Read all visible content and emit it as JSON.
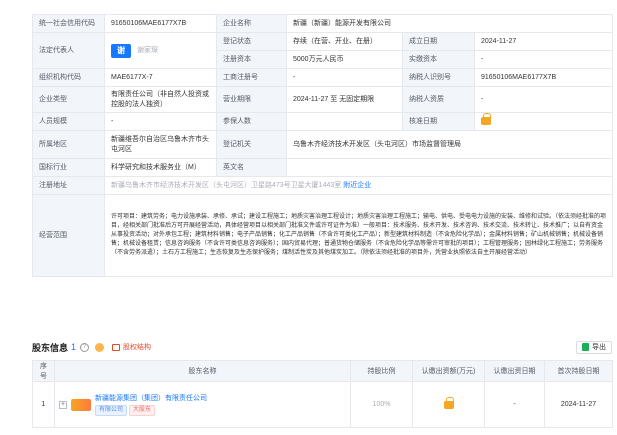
{
  "company": {
    "credit_code_label": "统一社会信用代码",
    "credit_code": "91650106MAE6177X7B",
    "name_label": "企业名称",
    "name": "新疆（新疆）能源开发有限公司",
    "legal_rep_label": "法定代表人",
    "legal_rep_logo": "谢",
    "legal_rep": "谢家琛",
    "status_label": "登记状态",
    "status": "存续（在营、开业、在册）",
    "est_date_label": "成立日期",
    "est_date": "2024-11-27",
    "reg_capital_label": "注册资本",
    "reg_capital": "5000万元人民币",
    "paid_capital_label": "实缴资本",
    "paid_capital": "-",
    "org_code_label": "组织机构代码",
    "org_code": "MAE6177X-7",
    "biz_reg_label": "工商注册号",
    "biz_reg": "-",
    "taxpayer_id_label": "纳税人识别号",
    "taxpayer_id": "91650106MAE6177X7B",
    "company_type_label": "企业类型",
    "company_type": "有限责任公司（非自然人投资或控股的法人独资）",
    "term_label": "营业期限",
    "term": "2024-11-27 至 无固定期限",
    "taxpayer_qual_label": "纳税人资质",
    "taxpayer_qual": "-",
    "staff_label": "人员规模",
    "staff": "-",
    "insured_label": "参保人数",
    "insured": "",
    "approval_date_label": "核准日期",
    "region_label": "所属地区",
    "region": "新疆维吾尔自治区乌鲁木齐市头屯河区",
    "authority_label": "登记机关",
    "authority": "乌鲁木齐经济技术开发区（头屯河区）市场监督管理局",
    "industry_label": "国标行业",
    "industry": "科学研究和技术服务业（M）",
    "english_label": "英文名",
    "english": "",
    "address_label": "注册地址",
    "address": "新疆乌鲁木齐市经济技术开发区（头屯河区）卫星路473号卫星大厦1443室",
    "nearby": "附近企业",
    "scope_label": "经营范围",
    "scope": "许可项目：建筑劳务；电力设施承装、承修、承试；建设工程施工；地质灾害治理工程设计；地质灾害治理工程施工；输电、供电、受电电力设施的安装、维修和试验。（依法须经批准的项目，经相关部门批准后方可开展经营活动，具体经营项目以相关部门批准文件或许可证件为准）一般项目：技术服务、技术开发、技术咨询、技术交流、技术转让、技术推广；以自有资金从事投资活动；对外承包工程；建筑材料销售；电子产品销售；化工产品销售（不含许可类化工产品）；新型建筑材料制造（不含危险化学品）；金属材料销售；矿山机械销售；机械设备销售；机械设备租赁；信息咨询服务（不含许可类信息咨询服务）；国内贸易代理；普通货物仓储服务（不含危险化学品等需许可审批的项目）；工程管理服务；园林绿化工程施工；劳务服务（不含劳务派遣）；土石方工程施工；生态恢复及生态保护服务；煤制活性炭及其他煤炭加工。（除依法须经批准的项目外，凭营业执照依法自主开展经营活动）"
  },
  "shareholders": {
    "title": "股东信息",
    "count": "1",
    "structure_link": "股权结构",
    "export": "导出",
    "columns": [
      "序号",
      "股东名称",
      "持股比例",
      "认缴出资额(万元)",
      "认缴出资日期",
      "首次持股日期"
    ],
    "rows": [
      {
        "index": "1",
        "expand": "+",
        "name": "新疆能源集团（集团）有限责任公司",
        "tag1": "有限公司",
        "tag2": "大股东",
        "ratio": "100%",
        "amount": "",
        "subscribe_date": "-",
        "first_date": "2024-11-27"
      }
    ]
  }
}
